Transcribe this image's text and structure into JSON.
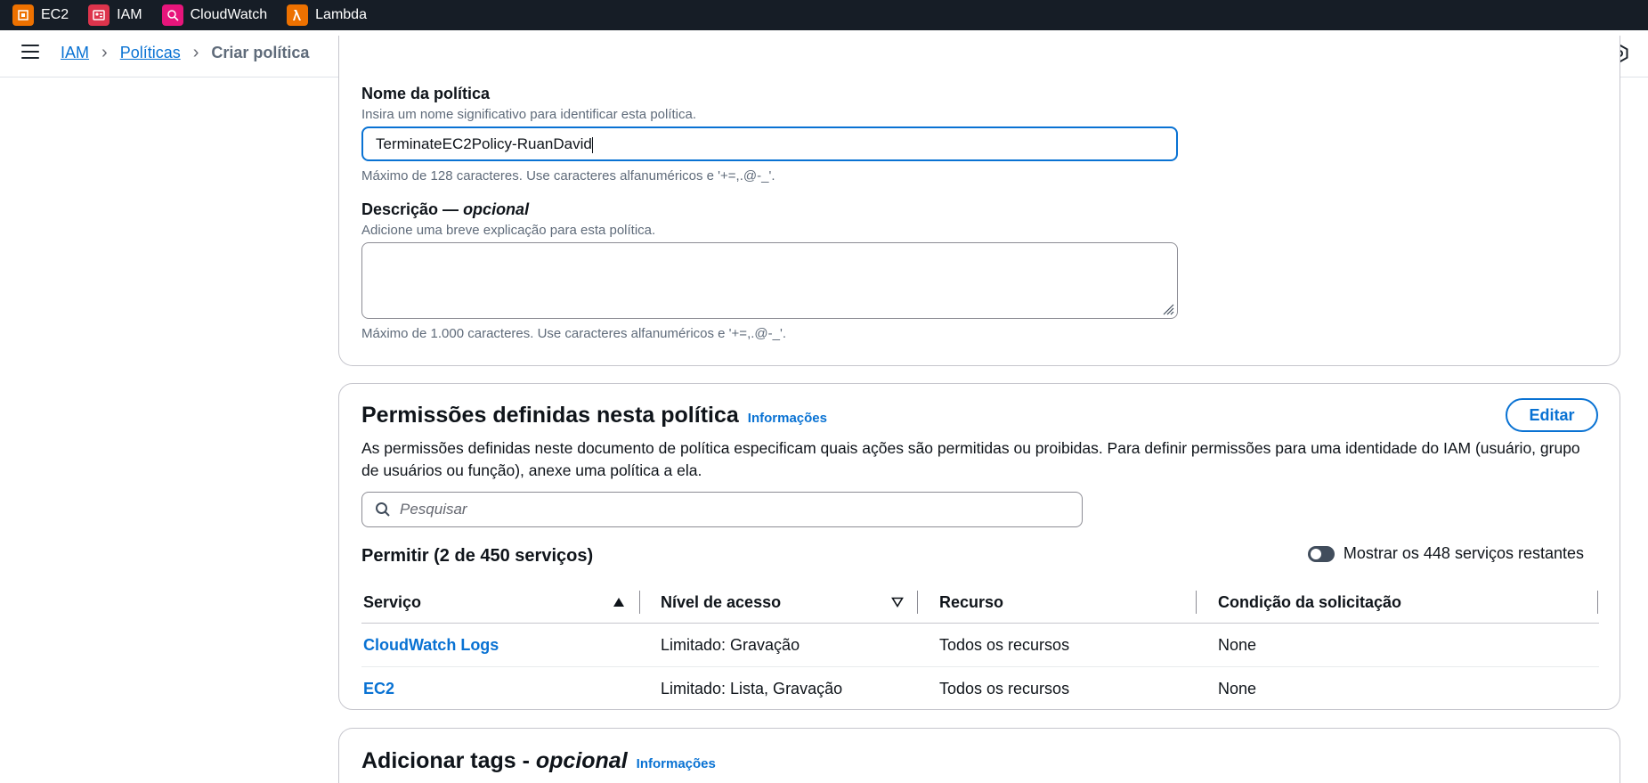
{
  "services_bar": [
    {
      "label": "EC2",
      "icon": "ec2-icon",
      "color": "#ed7100"
    },
    {
      "label": "IAM",
      "icon": "iam-icon",
      "color": "#dd344c"
    },
    {
      "label": "CloudWatch",
      "icon": "cloudwatch-icon",
      "color": "#e7157b"
    },
    {
      "label": "Lambda",
      "icon": "lambda-icon",
      "color": "#ed7100"
    }
  ],
  "breadcrumb": {
    "iam": "IAM",
    "policies": "Políticas",
    "current": "Criar política"
  },
  "policy_name": {
    "label": "Nome da política",
    "description": "Insira um nome significativo para identificar esta política.",
    "value": "TerminateEC2Policy-RuanDavid",
    "hint": "Máximo de 128 caracteres. Use caracteres alfanuméricos e '+=,.@-_'."
  },
  "description_field": {
    "label": "Descrição — ",
    "optional": "opcional",
    "description": "Adicione uma breve explicação para esta política.",
    "value": "",
    "hint": "Máximo de 1.000 caracteres. Use caracteres alfanuméricos e '+=,.@-_'."
  },
  "permissions": {
    "title": "Permissões definidas nesta política",
    "info": "Informações",
    "edit": "Editar",
    "description": "As permissões definidas neste documento de política especificam quais ações são permitidas ou proibidas. Para definir permissões para uma identidade do IAM (usuário, grupo de usuários ou função), anexe uma política a ela.",
    "search_placeholder": "Pesquisar",
    "allow_heading": "Permitir (2 de 450 serviços)",
    "toggle_label": "Mostrar os 448 serviços restantes",
    "toggle_on": false,
    "columns": [
      "Serviço",
      "Nível de acesso",
      "Recurso",
      "Condição da solicitação"
    ],
    "rows": [
      {
        "service": "CloudWatch Logs",
        "access": "Limitado: Gravação",
        "resource": "Todos os recursos",
        "condition": "None"
      },
      {
        "service": "EC2",
        "access": "Limitado: Lista, Gravação",
        "resource": "Todos os recursos",
        "condition": "None"
      }
    ]
  },
  "tags": {
    "title": "Adicionar tags - ",
    "optional": "opcional",
    "info": "Informações"
  }
}
